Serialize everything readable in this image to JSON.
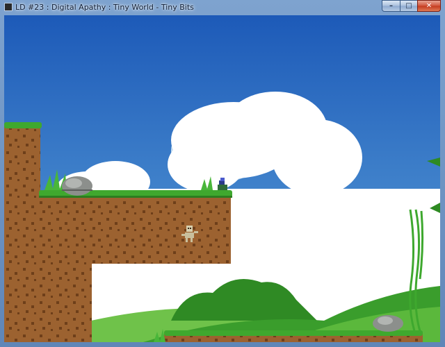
{
  "window": {
    "title": "LD #23 : Digital Apathy : Tiny World - Tiny Bits",
    "controls": {
      "minimize_glyph": "–",
      "maximize_glyph": "□",
      "close_glyph": "✕"
    }
  },
  "scene": {
    "sky_top_color": "#1d5ab8",
    "sky_bottom_color": "#5aa0d8",
    "grass_color": "#3fa82e",
    "dirt_color": "#9c6230",
    "hill_color": "#3a9d2c",
    "entities": [
      {
        "name": "player-character",
        "kind": "player"
      },
      {
        "name": "skeleton-enemy",
        "kind": "enemy"
      }
    ]
  }
}
